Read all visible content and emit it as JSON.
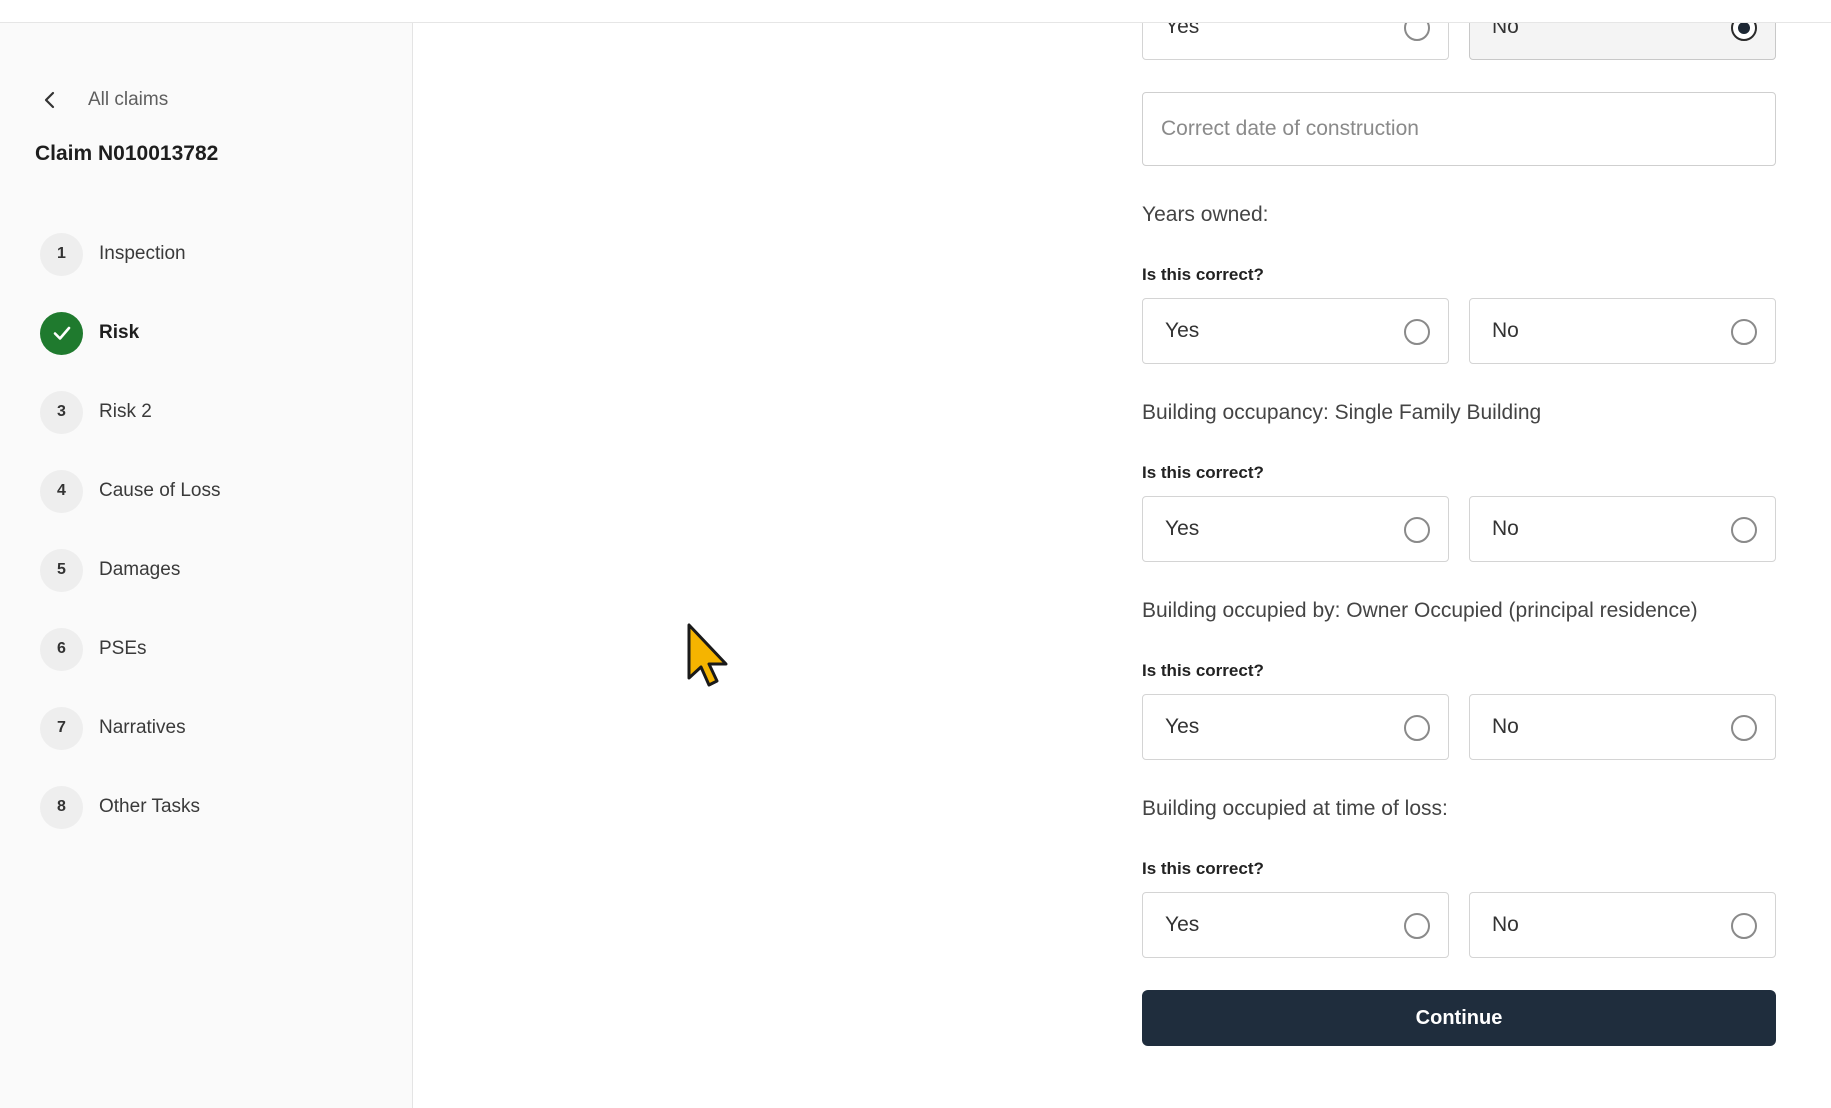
{
  "sidebar": {
    "back_label": "All claims",
    "claim_title": "Claim N010013782",
    "steps": [
      {
        "number": "1",
        "label": "Inspection",
        "status": "pending"
      },
      {
        "number": "",
        "label": "Risk",
        "status": "complete"
      },
      {
        "number": "3",
        "label": "Risk 2",
        "status": "pending"
      },
      {
        "number": "4",
        "label": "Cause of Loss",
        "status": "pending"
      },
      {
        "number": "5",
        "label": "Damages",
        "status": "pending"
      },
      {
        "number": "6",
        "label": "PSEs",
        "status": "pending"
      },
      {
        "number": "7",
        "label": "Narratives",
        "status": "pending"
      },
      {
        "number": "8",
        "label": "Other Tasks",
        "status": "pending"
      }
    ]
  },
  "form": {
    "top_radio": {
      "yes_label": "Yes",
      "no_label": "No",
      "selected": "No"
    },
    "construction_date": {
      "placeholder": "Correct date of construction",
      "value": ""
    },
    "question_label": "Is this correct?",
    "groups": [
      {
        "field": "Years owned:",
        "yes_label": "Yes",
        "no_label": "No",
        "selected": null
      },
      {
        "field": "Building occupancy: Single Family Building",
        "yes_label": "Yes",
        "no_label": "No",
        "selected": null
      },
      {
        "field": "Building occupied by: Owner Occupied (principal residence)",
        "yes_label": "Yes",
        "no_label": "No",
        "selected": null
      },
      {
        "field": "Building occupied at time of loss:",
        "yes_label": "Yes",
        "no_label": "No",
        "selected": null
      }
    ],
    "continue_label": "Continue"
  },
  "colors": {
    "primary_button": "#1f2d3d",
    "complete_step": "#1f7a2e",
    "cursor": "#f5b400"
  },
  "icons": {
    "back": "chevron-left-icon",
    "step_complete": "checkmark-icon",
    "pointer": "mouse-cursor-icon"
  }
}
